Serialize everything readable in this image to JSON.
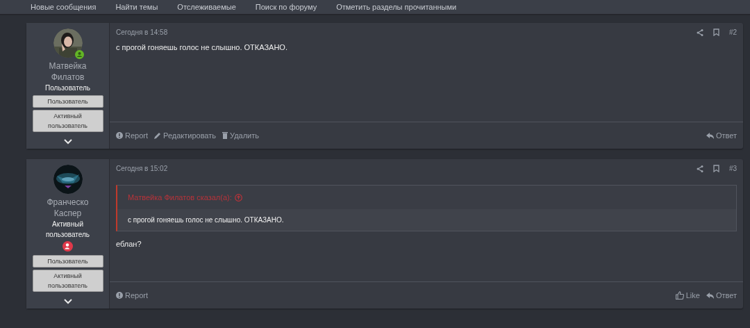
{
  "nav": [
    "Новые сообщения",
    "Найти темы",
    "Отслеживаемые",
    "Поиск по форуму",
    "Отметить разделы прочитанными"
  ],
  "posts": [
    {
      "author": {
        "name_lines": [
          "Матвейка",
          "Филатов"
        ],
        "title_lines": [
          "Пользователь"
        ],
        "online": true,
        "role_badge": false,
        "banners": [
          [
            "Пользователь"
          ],
          [
            "Активный",
            "пользователь"
          ]
        ]
      },
      "time": "Сегодня в 14:58",
      "number": "#2",
      "body": "с прогой гоняешь голос не слышно. ОТКАЗАНО.",
      "actions_left": [
        {
          "kind": "report",
          "label": "Report"
        },
        {
          "kind": "edit",
          "label": "Редактировать"
        },
        {
          "kind": "delete",
          "label": "Удалить"
        }
      ],
      "actions_right": [
        {
          "kind": "reply",
          "label": "Ответ"
        }
      ]
    },
    {
      "author": {
        "name_lines": [
          "Франческо",
          "Каспер"
        ],
        "title_lines": [
          "Активный",
          "пользователь"
        ],
        "online": false,
        "role_badge": true,
        "banners": [
          [
            "Пользователь"
          ],
          [
            "Активный",
            "пользователь"
          ]
        ]
      },
      "time": "Сегодня в 15:02",
      "number": "#3",
      "quote": {
        "attribution": "Матвейка Филатов сказал(а):",
        "text": "с прогой гоняешь голос не слышно. ОТКАЗАНО."
      },
      "body": "еблан?",
      "actions_left": [
        {
          "kind": "report",
          "label": "Report"
        }
      ],
      "actions_right": [
        {
          "kind": "like",
          "label": "Like"
        },
        {
          "kind": "reply",
          "label": "Ответ"
        }
      ]
    }
  ]
}
